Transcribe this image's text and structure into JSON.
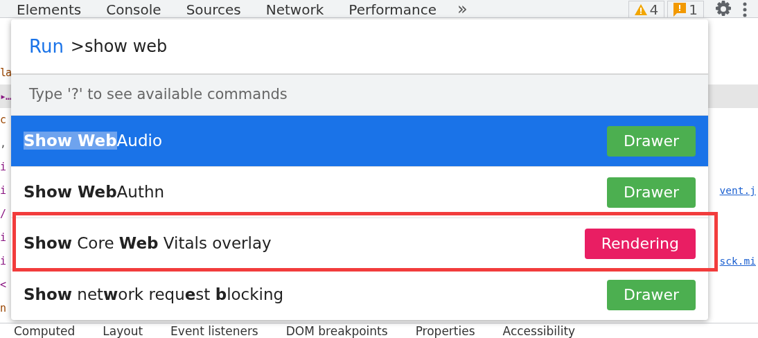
{
  "toolbar": {
    "tabs": [
      {
        "label": "Elements"
      },
      {
        "label": "Console"
      },
      {
        "label": "Sources"
      },
      {
        "label": "Network"
      },
      {
        "label": "Performance"
      }
    ],
    "more": "»",
    "warnings": "4",
    "issues": "1"
  },
  "background_code": [
    {
      "text": "la",
      "color": "#994500"
    },
    {
      "text": "▸…",
      "color": "#881280"
    },
    {
      "text": "c",
      "color": "#994500"
    },
    {
      "text": ",",
      "color": "#555555"
    },
    {
      "text": "i",
      "color": "#881280"
    },
    {
      "text": "i",
      "color": "#881280",
      "link": "vent.j"
    },
    {
      "text": "/",
      "color": "#881280"
    },
    {
      "text": "i",
      "color": "#881280"
    },
    {
      "text": "i",
      "color": "#881280",
      "link": "sck.mi"
    },
    {
      "text": "<",
      "color": "#881280"
    },
    {
      "text": "n",
      "color": "#994500"
    }
  ],
  "command_menu": {
    "prompt": "Run",
    "query": ">show web",
    "hint": "Type '?' to see available commands",
    "items": [
      {
        "label": "**Show Web**Audio",
        "selected": true,
        "badge": "Drawer",
        "color": "#4caf50",
        "outlined": false
      },
      {
        "label": "**Show Web**Authn",
        "selected": false,
        "badge": "Drawer",
        "color": "#4caf50",
        "outlined": false
      },
      {
        "label": "**Show** Core **Web** Vitals overlay",
        "selected": false,
        "badge": "Rendering",
        "color": "#e91e63",
        "outlined": true
      },
      {
        "label": "**Show** net**w**ork requ**e**st **b**locking",
        "selected": false,
        "badge": "Drawer",
        "color": "#4caf50",
        "outlined": false
      }
    ]
  },
  "bottom_tabs": [
    {
      "label": "Computed"
    },
    {
      "label": "Layout"
    },
    {
      "label": "Event listeners"
    },
    {
      "label": "DOM breakpoints"
    },
    {
      "label": "Properties"
    },
    {
      "label": "Accessibility"
    }
  ]
}
